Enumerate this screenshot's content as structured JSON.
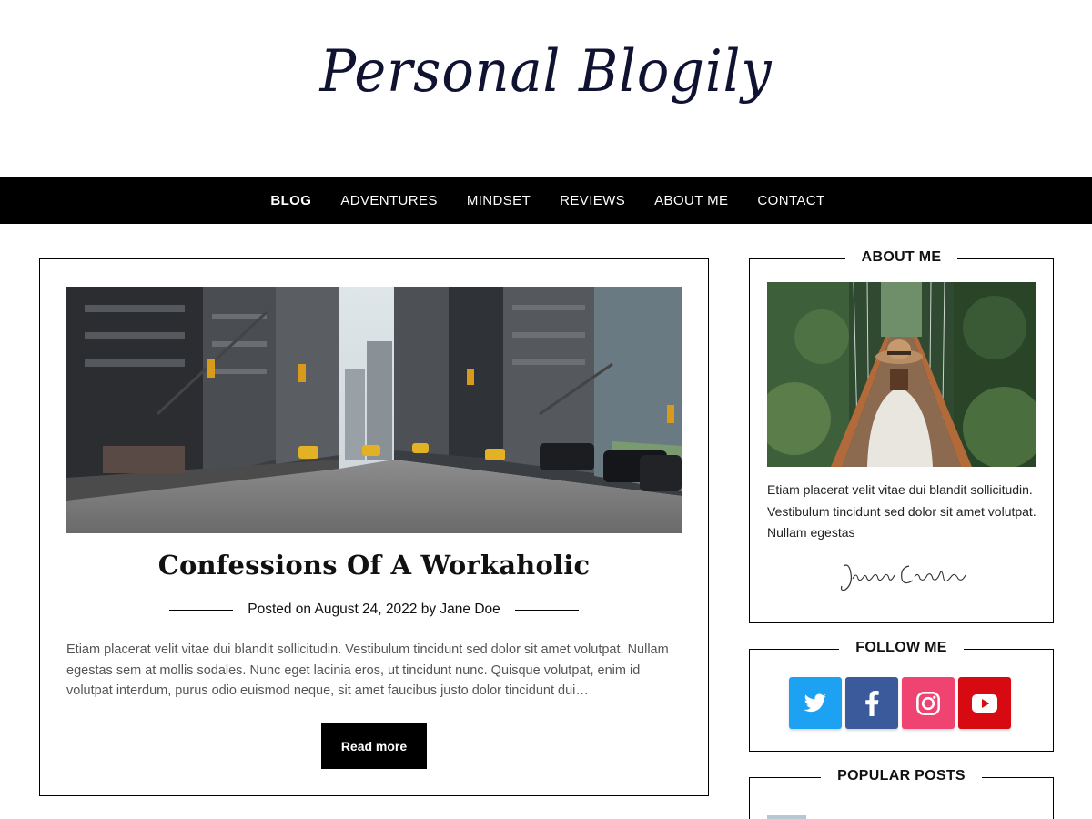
{
  "site": {
    "title": "Personal Blogily"
  },
  "nav": {
    "items": [
      {
        "label": "BLOG",
        "active": true
      },
      {
        "label": "ADVENTURES",
        "active": false
      },
      {
        "label": "MINDSET",
        "active": false
      },
      {
        "label": "REVIEWS",
        "active": false
      },
      {
        "label": "ABOUT ME",
        "active": false
      },
      {
        "label": "CONTACT",
        "active": false
      }
    ]
  },
  "post": {
    "title": "Confessions Of A Workaholic",
    "meta_prefix": "Posted on",
    "date": "August 24, 2022",
    "meta_by": "by",
    "author": "Jane Doe",
    "excerpt": "Etiam placerat velit vitae dui blandit sollicitudin. Vestibulum tincidunt sed dolor sit amet volutpat. Nullam egestas sem at mollis sodales. Nunc eget lacinia eros, ut tincidunt nunc. Quisque volutpat, enim id volutpat interdum, purus odio euismod neque, sit amet faucibus justo dolor tincidunt dui…",
    "read_more_label": "Read more"
  },
  "sidebar": {
    "about": {
      "title": "ABOUT ME",
      "text": "Etiam placerat velit vitae dui blandit sollicitudin. Vestibulum tincidunt sed dolor sit amet volutpat. Nullam egestas",
      "signature": "Jenifer Carter"
    },
    "follow": {
      "title": "FOLLOW ME",
      "icons": [
        "twitter-icon",
        "facebook-icon",
        "instagram-icon",
        "youtube-icon"
      ]
    },
    "popular": {
      "title": "POPULAR POSTS"
    }
  },
  "colors": {
    "nav_bg": "#000000",
    "title_color": "#0f1230",
    "twitter": "#1da1f2",
    "facebook": "#3b5a9c",
    "instagram": "#ef4371",
    "youtube": "#d60a10"
  }
}
